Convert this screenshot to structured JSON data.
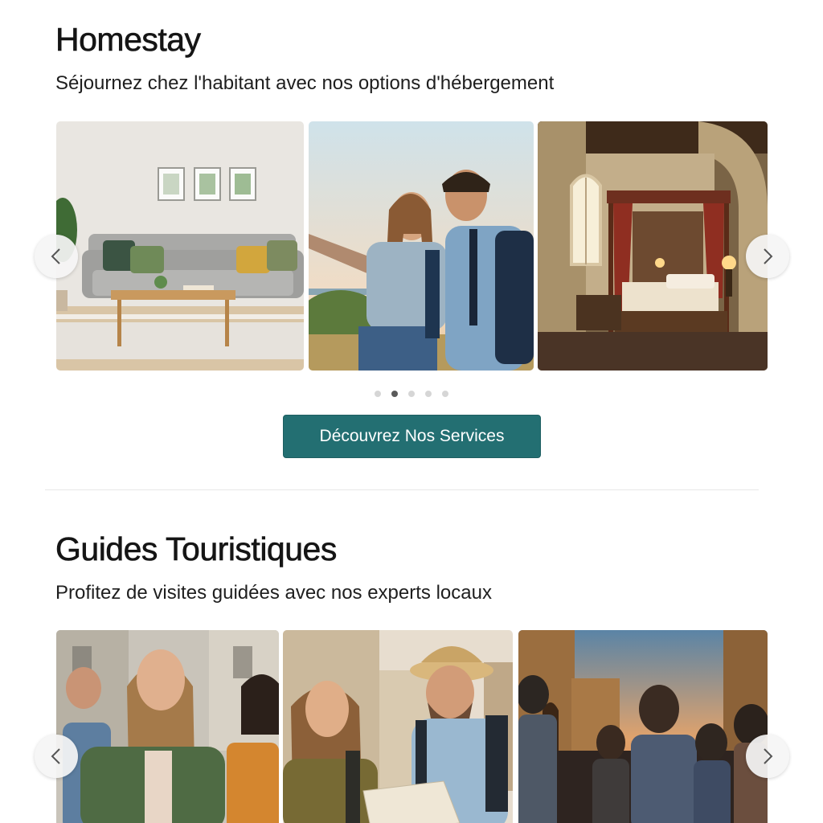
{
  "homestay": {
    "title": "Homestay",
    "subtitle": "Séjournez chez l'habitant avec nos options d'hébergement",
    "cta_label": "Découvrez Nos Services",
    "prev_icon": "chevron-left-icon",
    "next_icon": "chevron-right-icon",
    "slide_count": 5,
    "active_slide": 2
  },
  "guides": {
    "title": "Guides Touristiques",
    "subtitle": "Profitez de visites guidées avec nos experts locaux",
    "prev_icon": "chevron-left-icon",
    "next_icon": "chevron-right-icon"
  },
  "colors": {
    "accent": "#236f72",
    "dot_active": "#5a5a5a",
    "dot_inactive": "#d6d6d6"
  }
}
